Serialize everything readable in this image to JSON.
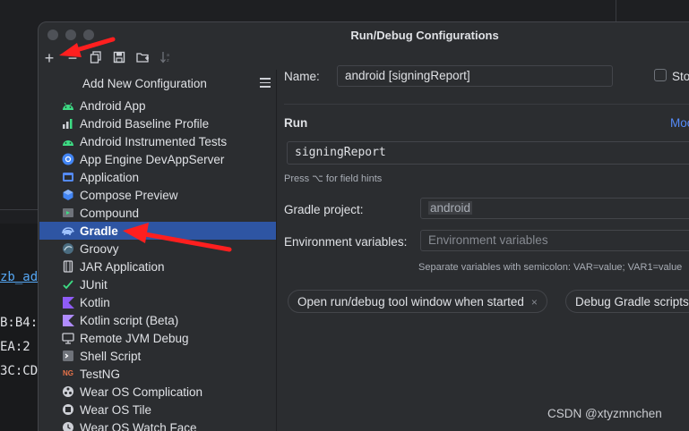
{
  "background": {
    "code_lines": [
      "zb_ad",
      "B:B4:",
      "EA:2",
      "3C:CD"
    ]
  },
  "dialog": {
    "title": "Run/Debug Configurations",
    "toolbar": {
      "add_label": "+",
      "remove_label": "−",
      "icons": [
        "plus-icon",
        "minus-icon",
        "copy-icon",
        "save-icon",
        "folder-icon",
        "sort-icon"
      ]
    },
    "popup": {
      "title": "Add New Configuration",
      "items": [
        {
          "label": "Android App",
          "icon": "android-icon"
        },
        {
          "label": "Android Baseline Profile",
          "icon": "baseline-profile-icon"
        },
        {
          "label": "Android Instrumented Tests",
          "icon": "android-test-icon"
        },
        {
          "label": "App Engine DevAppServer",
          "icon": "app-engine-icon"
        },
        {
          "label": "Application",
          "icon": "application-icon"
        },
        {
          "label": "Compose Preview",
          "icon": "compose-icon"
        },
        {
          "label": "Compound",
          "icon": "compound-icon"
        },
        {
          "label": "Gradle",
          "icon": "gradle-icon",
          "selected": true
        },
        {
          "label": "Groovy",
          "icon": "groovy-icon"
        },
        {
          "label": "JAR Application",
          "icon": "jar-icon"
        },
        {
          "label": "JUnit",
          "icon": "junit-icon"
        },
        {
          "label": "Kotlin",
          "icon": "kotlin-icon"
        },
        {
          "label": "Kotlin script (Beta)",
          "icon": "kotlin-script-icon"
        },
        {
          "label": "Remote JVM Debug",
          "icon": "remote-debug-icon"
        },
        {
          "label": "Shell Script",
          "icon": "shell-icon"
        },
        {
          "label": "TestNG",
          "icon": "testng-icon"
        },
        {
          "label": "Wear OS Complication",
          "icon": "wear-complication-icon"
        },
        {
          "label": "Wear OS Tile",
          "icon": "wear-tile-icon"
        },
        {
          "label": "Wear OS Watch Face",
          "icon": "wear-watchface-icon"
        }
      ]
    },
    "form": {
      "name_label": "Name:",
      "name_value": "android [signingReport]",
      "store_label": "Sto",
      "run_label": "Run",
      "modify_link": "Moc",
      "run_value": "signingReport",
      "field_hint": "Press ⌥ for field hints",
      "gradle_project_label": "Gradle project:",
      "gradle_project_value": "android",
      "env_label": "Environment variables:",
      "env_placeholder": "Environment variables",
      "env_hint": "Separate variables with semicolon: VAR=value; VAR1=value",
      "chip_open_tool": "Open run/debug tool window when started",
      "chip_close": "×",
      "chip_debug": "Debug Gradle scripts"
    }
  },
  "watermark": "CSDN @xtyzmnchen",
  "colors": {
    "selection": "#2e55a3",
    "annotation_arrow": "#ff1f1f",
    "link": "#548af7"
  }
}
